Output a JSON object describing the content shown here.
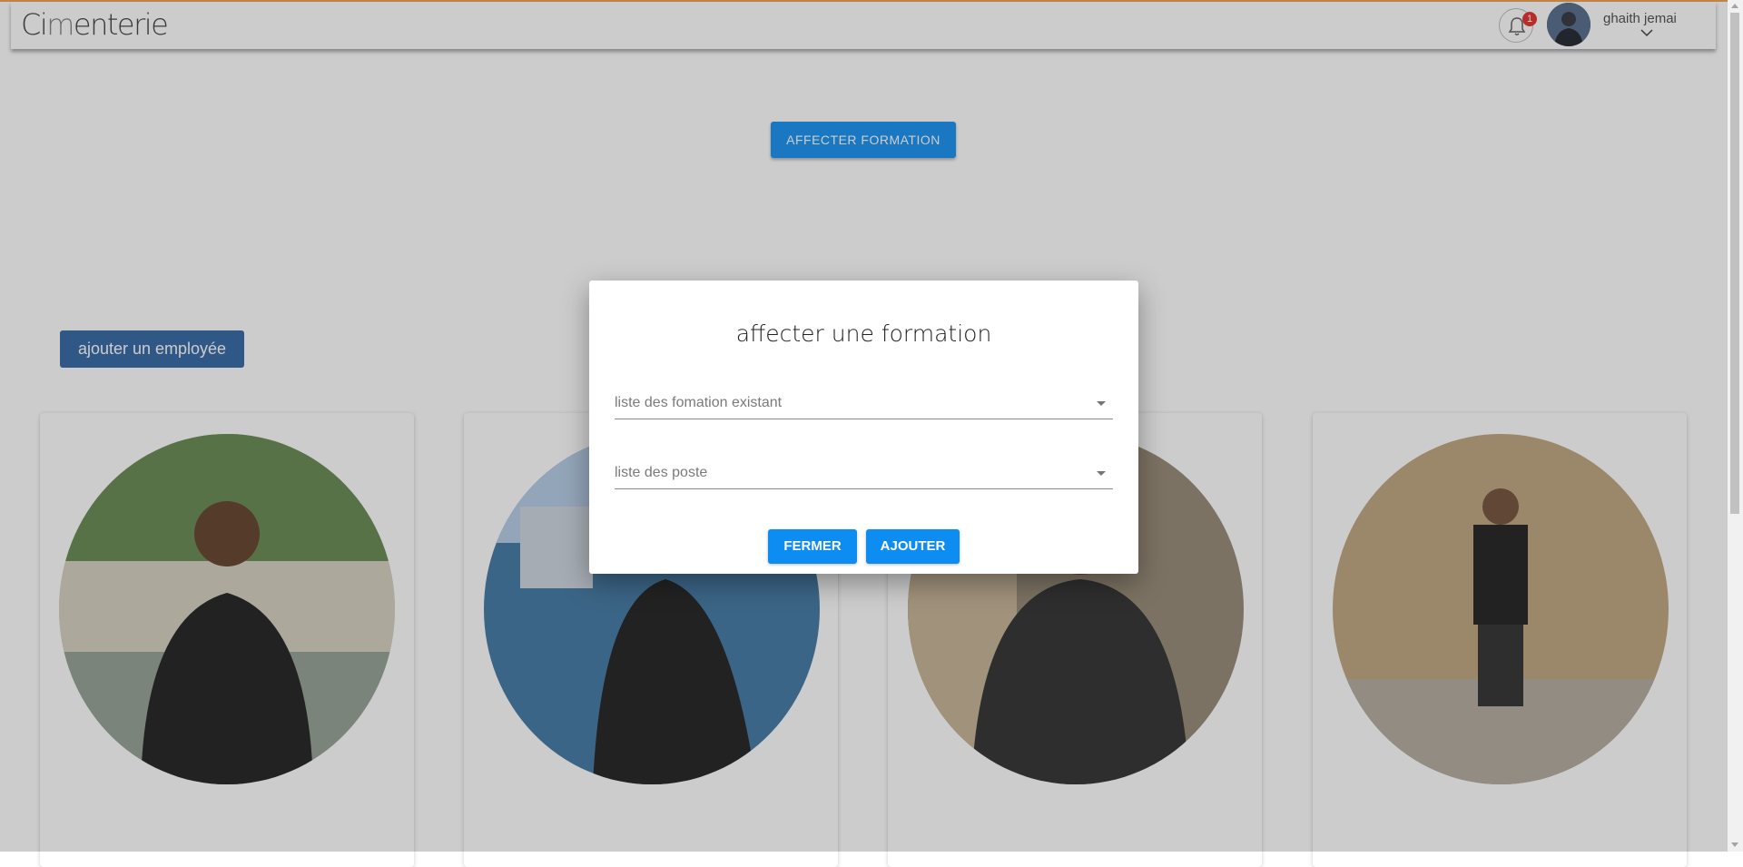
{
  "navbar": {
    "brand_first": "Ci",
    "brand_mid": "m",
    "brand_rest": "enterie",
    "notification_count": "1",
    "user_name": "ghaith jemai"
  },
  "main": {
    "assign_button_label": "AFFECTER FORMATION",
    "add_employee_label": "ajouter un employée",
    "employee_cards": [
      {
        "photo": "employee-photo-1"
      },
      {
        "photo": "employee-photo-2"
      },
      {
        "photo": "employee-photo-3"
      },
      {
        "photo": "employee-photo-4"
      }
    ]
  },
  "modal": {
    "title": "affecter une formation",
    "training_select_placeholder": "liste des fomation existant",
    "post_select_placeholder": "liste des poste",
    "close_label": "FERMER",
    "add_label": "AJOUTER"
  },
  "colors": {
    "primary_button": "#0d8cf2",
    "assign_button": "#2196f3",
    "add_employee_button": "#3c6ea8",
    "badge": "#e53935",
    "top_accent": "#f2a65a"
  },
  "icons": [
    "bell-icon",
    "chevron-down-icon",
    "dropdown-caret-icon"
  ]
}
